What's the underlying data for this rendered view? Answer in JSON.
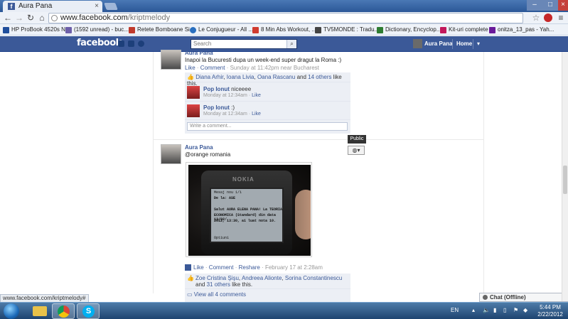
{
  "browser": {
    "tab_title": "Aura Pana",
    "tab_close": "×",
    "window_controls": {
      "minimize": "–",
      "maximize": "□",
      "close": "×"
    },
    "url_domain": "www.facebook.com",
    "url_path": "/kriptmelody"
  },
  "bookmarks": [
    {
      "label": "HP ProBook 4520s N...",
      "color": "#1f4e9c"
    },
    {
      "label": "(1592 unread) - buc...",
      "color": "#6d5fa9"
    },
    {
      "label": "Retete Bomboane Si...",
      "color": "#c0392b"
    },
    {
      "label": "Le Conjugueur - All ...",
      "color": "#2a6fbf"
    },
    {
      "label": "8 Min Abs Workout, ...",
      "color": "#d03b2f"
    },
    {
      "label": "TV5MONDE : Tradu...",
      "color": "#444444"
    },
    {
      "label": "Dictionary, Encyclop...",
      "color": "#2e7d32"
    },
    {
      "label": "Kit-uri complete",
      "color": "#c2185b"
    },
    {
      "label": "onitza_13_pas - Yah...",
      "color": "#6a1b9a"
    }
  ],
  "facebook": {
    "logo": "facebook",
    "search_placeholder": "Search",
    "user_name": "Aura Pana",
    "home_label": "Home",
    "dropdown": "▾"
  },
  "posts": [
    {
      "author": "Aura Pana",
      "text": "Inapoi la Bucuresti dupa un week-end super dragut la Roma :)",
      "actions": {
        "like": "Like",
        "comment": "Comment",
        "time": "Sunday at 11:42pm near Bucharest"
      },
      "likes": {
        "names": [
          "Diana Arhir",
          "Ioana Livia",
          "Oana Rascanu"
        ],
        "others": "14 others",
        "suffix": "like this.",
        "and": "and"
      },
      "comments": [
        {
          "author": "Pop Ionut",
          "text": "niceeee",
          "time": "Monday at 12:34am",
          "like": "Like"
        },
        {
          "author": "Pop Ionut",
          "text": ":)",
          "time": "Monday at 12:34am",
          "like": "Like"
        }
      ],
      "comment_placeholder": "Write a comment..."
    },
    {
      "author": "Aura Pana",
      "text": "@orange romania",
      "photo": {
        "brand": "NOKIA",
        "lines": [
          "Mesaj nou 1/1",
          "De la: ASE",
          "",
          "Salut AURA ELENA PANA! La TEORIA",
          "ECONOMICA (Standard) din data 13/02/",
          "2012, 13:30, ai luat nota 10.",
          "",
          "Optiuni"
        ]
      },
      "actions": {
        "like": "Like",
        "comment": "Comment",
        "reshare": "Reshare",
        "time": "February 17 at 2:28am"
      },
      "likes": {
        "names": [
          "Zoe Cristina Şişu",
          "Andreea Alionte",
          "Sorina Constantinescu"
        ],
        "others": "31 others",
        "suffix": "like this.",
        "and": "and"
      },
      "view_all": "View all 4 comments",
      "privacy_tooltip": "Public",
      "privacy_icon": "globe-icon"
    }
  ],
  "status_url": "www.facebook.com/kriptmelody#",
  "chat": {
    "label": "Chat (Offline)"
  },
  "taskbar": {
    "language": "EN",
    "time": "5:44 PM",
    "date": "2/22/2012"
  }
}
